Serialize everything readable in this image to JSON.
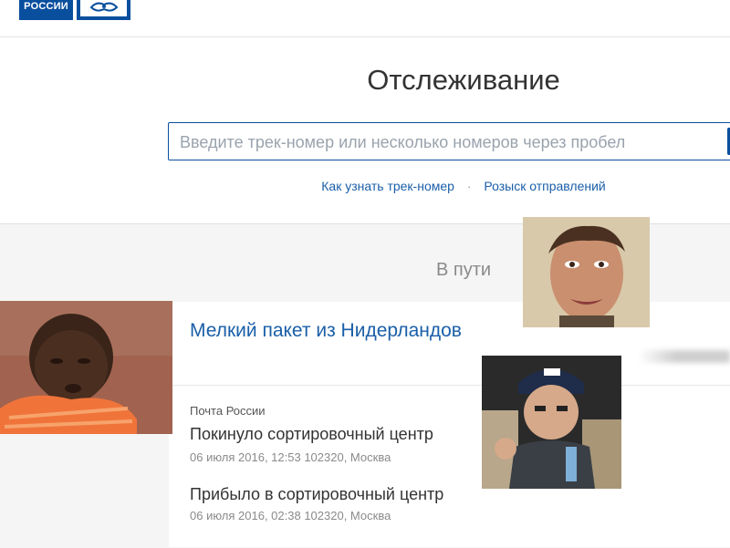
{
  "header": {
    "logo_text": "РОССИИ",
    "emblem_icon": "post-horn-icon"
  },
  "page": {
    "title": "Отслеживание"
  },
  "search": {
    "placeholder": "Введите трек-номер или несколько номеров через пробел",
    "value": ""
  },
  "links": {
    "how_to": "Как узнать трек-номер",
    "separator": "·",
    "search_parcels": "Розыск отправлений"
  },
  "status": {
    "label": "В пути"
  },
  "parcel": {
    "title": "Мелкий пакет из Нидерландов",
    "carrier": "Почта России",
    "events": [
      {
        "title": "Покинуло сортировочный центр",
        "meta": "06 июля 2016, 12:53 102320, Москва"
      },
      {
        "title": "Прибыло в сортировочный центр",
        "meta": "06 июля 2016, 02:38 102320, Москва"
      }
    ]
  },
  "colors": {
    "brand": "#0a4f9e",
    "link": "#1a5fa8",
    "muted": "#8a8a8a",
    "section_bg": "#f5f5f5"
  },
  "overlays": {
    "meme_kid": "meme-photo-kid",
    "meme_man": "meme-photo-man",
    "meme_actor": "meme-photo-actor"
  }
}
